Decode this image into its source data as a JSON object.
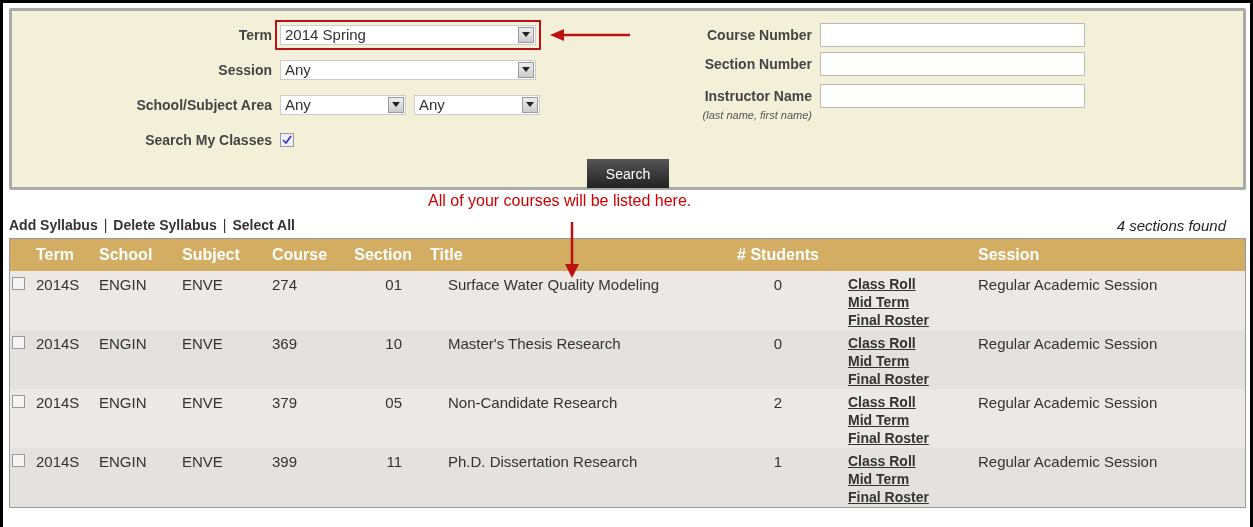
{
  "filters": {
    "term": {
      "label": "Term",
      "value": "2014 Spring",
      "highlighted": true
    },
    "session": {
      "label": "Session",
      "value": "Any"
    },
    "school_subject": {
      "label": "School/Subject Area",
      "school": "Any",
      "subject": "Any"
    },
    "search_my_classes": {
      "label": "Search My Classes",
      "checked": true
    },
    "course_number": {
      "label": "Course Number"
    },
    "section_number": {
      "label": "Section Number"
    },
    "instructor_name": {
      "label": "Instructor Name",
      "hint": "(last name, first name)"
    },
    "search_button": "Search"
  },
  "annotation": "All of your courses will be listed here.",
  "actions": [
    "Add Syllabus",
    "Delete Syllabus",
    "Select All"
  ],
  "separator": "|",
  "count": "4 sections found",
  "table": {
    "columns": [
      "Term",
      "School",
      "Subject",
      "Course",
      "Section",
      "Title",
      "# Students",
      "Session"
    ],
    "rows": [
      {
        "checked": false,
        "term": "2014S",
        "school": "ENGIN",
        "subject": "ENVE",
        "course": "274",
        "section": "01",
        "title": "Surface Water Quality Modeling",
        "students": "0",
        "links": [
          "Class Roll",
          "Mid Term",
          "Final Roster"
        ],
        "session": "Regular Academic Session"
      },
      {
        "checked": false,
        "term": "2014S",
        "school": "ENGIN",
        "subject": "ENVE",
        "course": "369",
        "section": "10",
        "title": "Master's Thesis Research",
        "students": "0",
        "links": [
          "Class Roll",
          "Mid Term",
          "Final Roster"
        ],
        "session": "Regular Academic Session"
      },
      {
        "checked": false,
        "term": "2014S",
        "school": "ENGIN",
        "subject": "ENVE",
        "course": "379",
        "section": "05",
        "title": "Non-Candidate Research",
        "students": "2",
        "links": [
          "Class Roll",
          "Mid Term",
          "Final Roster"
        ],
        "session": "Regular Academic Session"
      },
      {
        "checked": false,
        "term": "2014S",
        "school": "ENGIN",
        "subject": "ENVE",
        "course": "399",
        "section": "11",
        "title": "Ph.D. Dissertation Research",
        "students": "1",
        "links": [
          "Class Roll",
          "Mid Term",
          "Final Roster"
        ],
        "session": "Regular Academic Session"
      }
    ]
  }
}
